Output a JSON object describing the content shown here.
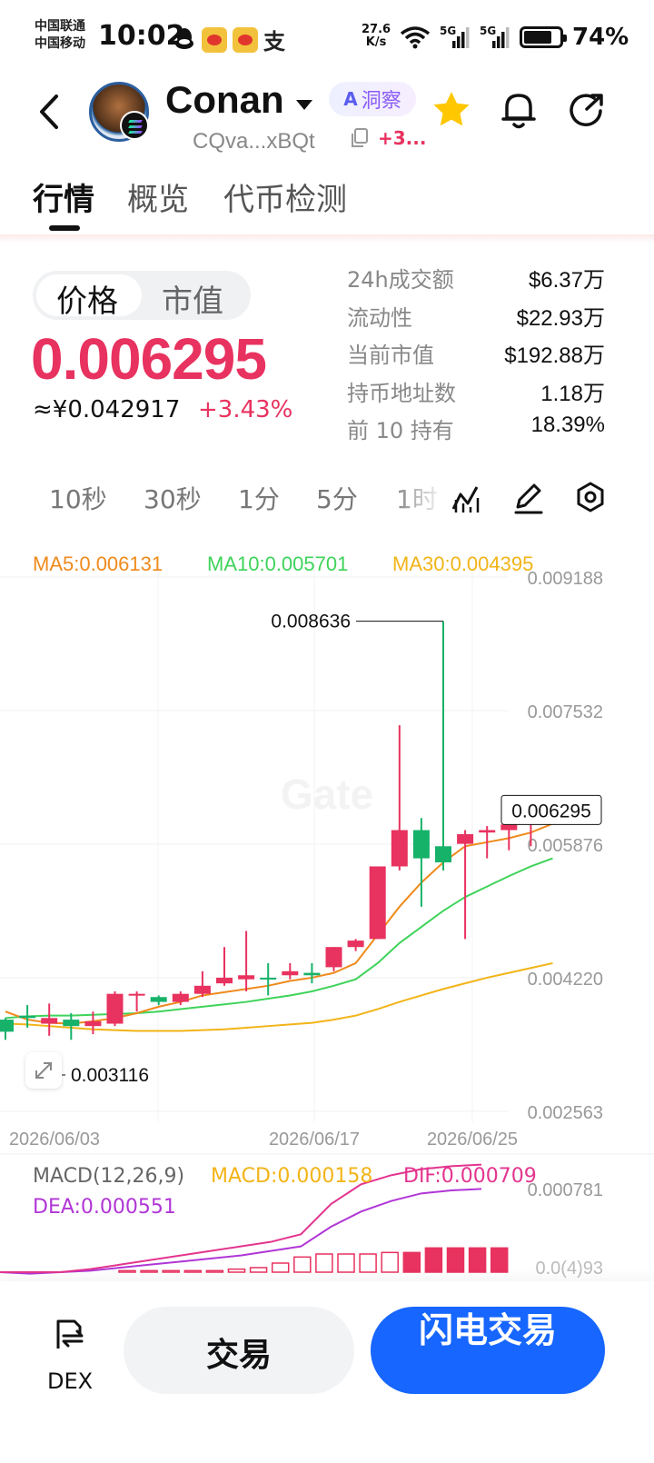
{
  "status_bar": {
    "carrier_1": "中国联通",
    "carrier_2": "中国移动",
    "time": "10:02",
    "net_speed_value": "27.6",
    "net_speed_unit": "K/s",
    "signal_1": "5G",
    "signal_2": "5G",
    "battery": "74%",
    "app_icons": [
      "qq-icon",
      "weibo-icon",
      "weibo-icon",
      "alipay-icon"
    ]
  },
  "header": {
    "token_name": "Conan",
    "ai_label": "洞察",
    "ai_badge": "A",
    "address": "CQva...xBQt",
    "more": "+3...",
    "icons": [
      "back-icon",
      "star-icon",
      "bell-icon",
      "share-icon"
    ]
  },
  "tabs": [
    {
      "label": "行情",
      "active": true
    },
    {
      "label": "概览",
      "active": false
    },
    {
      "label": "代币检测",
      "active": false
    }
  ],
  "price": {
    "toggle": [
      "价格",
      "市值"
    ],
    "value": "0.006295",
    "cny": "≈¥0.042917",
    "change": "+3.43%"
  },
  "stats": [
    {
      "label": "24h成交额",
      "value": "$6.37万"
    },
    {
      "label": "流动性",
      "value": "$22.93万"
    },
    {
      "label": "当前市值",
      "value": "$192.88万"
    },
    {
      "label": "持币地址数",
      "value": "1.18万"
    },
    {
      "label": "前 10 持有",
      "value": "18.39%"
    }
  ],
  "intervals": [
    "10秒",
    "30秒",
    "1分",
    "5分",
    "1时"
  ],
  "colors": {
    "up": "#e8325f",
    "down": "#17b26a",
    "ma5": "#ef8a1c",
    "ma10": "#3fd35a",
    "ma30": "#f2b417",
    "dif": "#e3358f",
    "dea": "#b036d6",
    "accent": "#1666ff"
  },
  "chart_data": {
    "type": "candlestick",
    "legend": {
      "ma5": "MA5:0.006131",
      "ma10": "MA10:0.005701",
      "ma30": "MA30:0.004395"
    },
    "y_ticks": [
      "0.009188",
      "0.007532",
      "0.005876",
      "0.004220",
      "0.002563"
    ],
    "ylim": [
      0.002563,
      0.009188
    ],
    "x_ticks": [
      "2026/06/03",
      "2026/06/17",
      "2026/06/25"
    ],
    "high_label": "0.008636",
    "low_label": "0.003116",
    "last_label": "0.006295",
    "candles": [
      [
        0.0037,
        0.00355,
        0.00372,
        0.00345
      ],
      [
        0.00375,
        0.00372,
        0.00388,
        0.0036
      ],
      [
        0.00365,
        0.00372,
        0.0039,
        0.0035
      ],
      [
        0.0037,
        0.00362,
        0.00378,
        0.00345
      ],
      [
        0.00362,
        0.00368,
        0.0038,
        0.00352
      ],
      [
        0.00365,
        0.00402,
        0.00405,
        0.00362
      ],
      [
        0.004,
        0.00402,
        0.00405,
        0.0038
      ],
      [
        0.00398,
        0.00392,
        0.004,
        0.00388
      ],
      [
        0.00392,
        0.00402,
        0.00405,
        0.00388
      ],
      [
        0.00402,
        0.00412,
        0.0043,
        0.00398
      ],
      [
        0.00415,
        0.00422,
        0.0046,
        0.00412
      ],
      [
        0.0042,
        0.00425,
        0.0048,
        0.00405
      ],
      [
        0.00422,
        0.0042,
        0.0044,
        0.004
      ],
      [
        0.00425,
        0.0043,
        0.0044,
        0.0042
      ],
      [
        0.00428,
        0.00425,
        0.0044,
        0.00415
      ],
      [
        0.00435,
        0.0046,
        0.0046,
        0.0043
      ],
      [
        0.0046,
        0.00468,
        0.0047,
        0.00455
      ],
      [
        0.0047,
        0.0056,
        0.0056,
        0.0047
      ],
      [
        0.0056,
        0.00605,
        0.00735,
        0.00555
      ],
      [
        0.00605,
        0.0057,
        0.0062,
        0.0051
      ],
      [
        0.00585,
        0.00565,
        0.00864,
        0.00555
      ],
      [
        0.00588,
        0.006,
        0.00605,
        0.0047
      ],
      [
        0.00602,
        0.00605,
        0.0061,
        0.0057
      ],
      [
        0.00605,
        0.00612,
        0.0062,
        0.0058
      ],
      [
        0.00612,
        0.0062,
        0.00625,
        0.00585
      ],
      [
        0.0062,
        0.0063,
        0.00635,
        0.00615
      ]
    ],
    "ma5": [
      0.0038,
      0.0037,
      0.00366,
      0.00365,
      0.00368,
      0.00372,
      0.00378,
      0.00386,
      0.00392,
      0.004,
      0.00404,
      0.00408,
      0.00412,
      0.00418,
      0.00422,
      0.00428,
      0.0044,
      0.00475,
      0.0051,
      0.0054,
      0.00565,
      0.00585,
      0.0059,
      0.00595,
      0.00602,
      0.00613
    ],
    "ma10": [
      0.00372,
      0.00374,
      0.00375,
      0.00375,
      0.00376,
      0.00377,
      0.00378,
      0.0038,
      0.00383,
      0.00386,
      0.00389,
      0.00392,
      0.00396,
      0.004,
      0.00405,
      0.00412,
      0.0042,
      0.0044,
      0.00465,
      0.00485,
      0.00505,
      0.00522,
      0.00535,
      0.00548,
      0.0056,
      0.0057
    ],
    "ma30": [
      0.00365,
      0.00364,
      0.00362,
      0.0036,
      0.00358,
      0.00357,
      0.00356,
      0.00356,
      0.00356,
      0.00357,
      0.00358,
      0.0036,
      0.00362,
      0.00364,
      0.00366,
      0.0037,
      0.00375,
      0.00383,
      0.00392,
      0.004,
      0.00408,
      0.00415,
      0.00422,
      0.00428,
      0.00434,
      0.0044
    ]
  },
  "macd": {
    "label": "MACD(12,26,9)",
    "macd": "MACD:0.000158",
    "dif": "DIF:0.000709",
    "dea": "DEA:0.000551",
    "y_tick_top": "0.000781",
    "y_tick_mid": "0.0(4)93",
    "dif_values": [
      0.0,
      0.0,
      0.0,
      2e-05,
      5e-05,
      8e-05,
      0.00011,
      0.00014,
      0.00017,
      0.0002,
      0.00025,
      0.00045,
      0.00058,
      0.00064,
      0.00068,
      0.0007,
      0.00071
    ],
    "dea_values": [
      0.0,
      -1e-05,
      0.0,
      1e-05,
      3e-05,
      5e-05,
      7e-05,
      9e-05,
      0.00011,
      0.00014,
      0.00017,
      0.0003,
      0.0004,
      0.00047,
      0.00052,
      0.00054,
      0.00055
    ],
    "hist_values": [
      1e-05,
      1e-05,
      1e-05,
      1e-05,
      1e-05,
      2e-05,
      3e-05,
      6e-05,
      0.0001,
      0.00012,
      0.00012,
      0.00012,
      0.00013,
      0.00013,
      0.00016,
      0.00016,
      0.00016,
      0.00016
    ]
  },
  "bottom": {
    "dex_label": "DEX",
    "trade_label": "交易",
    "flash_label": "闪电交易"
  }
}
